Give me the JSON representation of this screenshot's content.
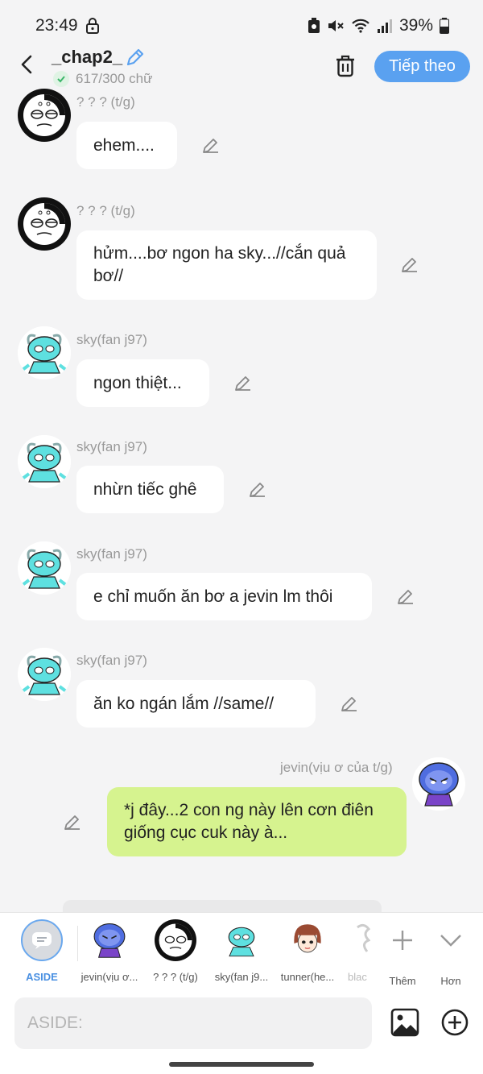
{
  "status_bar": {
    "time": "23:49",
    "battery": "39%",
    "icons": [
      "lock-icon",
      "recycle-icon",
      "mute-icon",
      "wifi-icon",
      "signal-icon",
      "battery-icon"
    ]
  },
  "header": {
    "title": "_chap2_",
    "word_count": "617/300 chữ",
    "next_label": "Tiếp theo",
    "accent": "#5aa1f0"
  },
  "messages": [
    {
      "sender": "? ? ? (t/g)",
      "text": "ehem....",
      "side": "left",
      "avatar": "skull-face-avatar"
    },
    {
      "sender": "? ? ? (t/g)",
      "text": "hửm....bơ ngon ha sky...//cắn quả bơ//",
      "side": "left",
      "avatar": "skull-face-avatar"
    },
    {
      "sender": "sky(fan j97)",
      "text": "ngon thiệt...",
      "side": "left",
      "avatar": "cyan-creature-avatar"
    },
    {
      "sender": "sky(fan j97)",
      "text": "nhừn tiếc ghê",
      "side": "left",
      "avatar": "cyan-creature-avatar"
    },
    {
      "sender": "sky(fan j97)",
      "text": "e chỉ muốn ăn bơ a jevin lm thôi",
      "side": "left",
      "avatar": "cyan-creature-avatar"
    },
    {
      "sender": "sky(fan j97)",
      "text": "ăn ko ngán lắm //same//",
      "side": "left",
      "avatar": "cyan-creature-avatar"
    },
    {
      "sender": "jevin(vịu ơ của t/g)",
      "text": "*j đây...2 con ng này lên cơn điên giống cục cuk này à...",
      "side": "right",
      "avatar": "blue-creature-avatar"
    }
  ],
  "characters": [
    {
      "label": "ASIDE",
      "icon": "aside-icon"
    },
    {
      "label": "jevin(vịu ơ...",
      "icon": "blue-creature-avatar"
    },
    {
      "label": "? ? ? (t/g)",
      "icon": "skull-face-avatar"
    },
    {
      "label": "sky(fan j9...",
      "icon": "cyan-creature-avatar"
    },
    {
      "label": "tunner(he...",
      "icon": "red-hair-girl-avatar"
    },
    {
      "label": "blac",
      "icon": "partial-avatar"
    }
  ],
  "char_actions": {
    "more_label": "Thêm",
    "collapse_label": "Hơn"
  },
  "input": {
    "placeholder": "ASIDE:"
  }
}
